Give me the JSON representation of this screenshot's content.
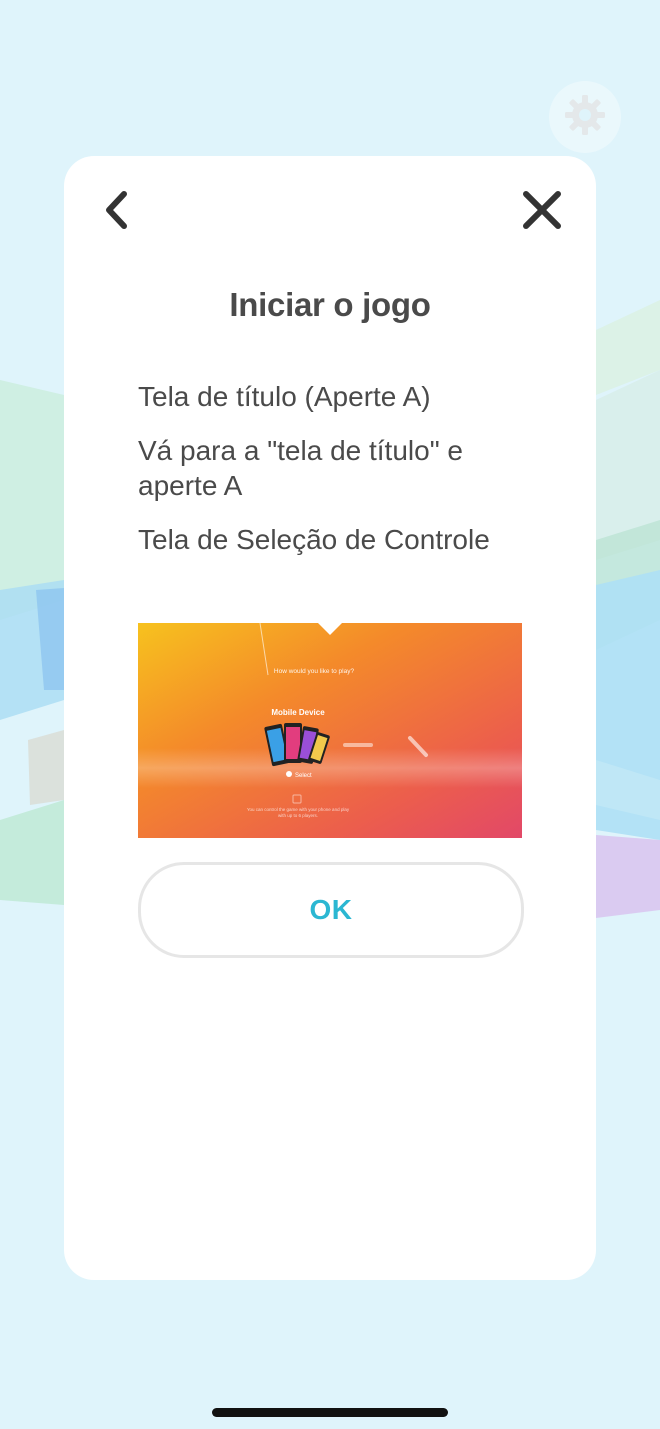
{
  "dialog": {
    "title": "Iniciar o jogo",
    "steps": [
      "Tela de título (Aperte A)",
      "Vá para a \"tela de título\" e aperte A",
      "Tela de Seleção de Controle"
    ],
    "ok_label": "OK"
  },
  "preview": {
    "question": "How would you like to play?",
    "option_label": "Mobile Device",
    "select_label": "Select",
    "caption_line1": "You can control the game with your phone and play",
    "caption_line2": "with up to 6 players."
  },
  "colors": {
    "background": "#dff4fb",
    "card": "#ffffff",
    "title_text": "#4a4a4a",
    "ok_text": "#2bb7d2",
    "ok_border": "#e6e6e6"
  },
  "icons": {
    "settings": "gear-icon",
    "back": "chevron-left-icon",
    "close": "close-icon"
  }
}
